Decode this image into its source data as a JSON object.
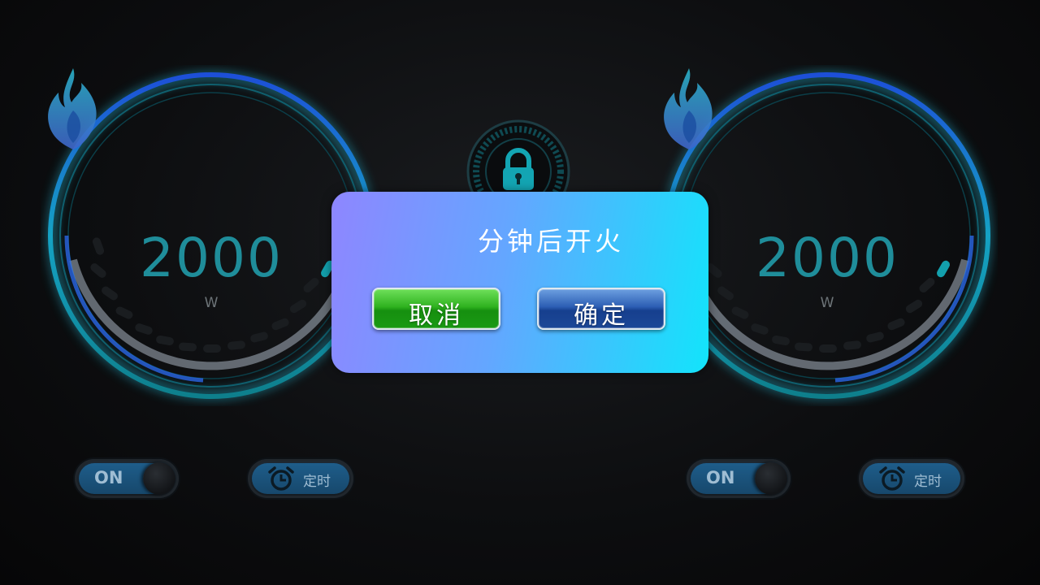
{
  "burners": [
    {
      "id": "left",
      "power_value": "2000",
      "power_unit": "W",
      "switch_label": "ON",
      "timer_label": "定时"
    },
    {
      "id": "right",
      "power_value": "2000",
      "power_unit": "W",
      "switch_label": "ON",
      "timer_label": "定时"
    }
  ],
  "center": {
    "lock_icon": "lock-icon"
  },
  "dialog": {
    "message": "分钟后开火",
    "cancel_label": "取消",
    "confirm_label": "确定"
  },
  "colors": {
    "ring_glow": "#12a6b8",
    "ring_blue": "#1f5fd0",
    "value_text": "#1f8d9a",
    "dialog_start": "#8e86ff",
    "dialog_end": "#12e4fb",
    "cancel_green": "#2fb21f",
    "confirm_blue": "#2c5eb4"
  }
}
